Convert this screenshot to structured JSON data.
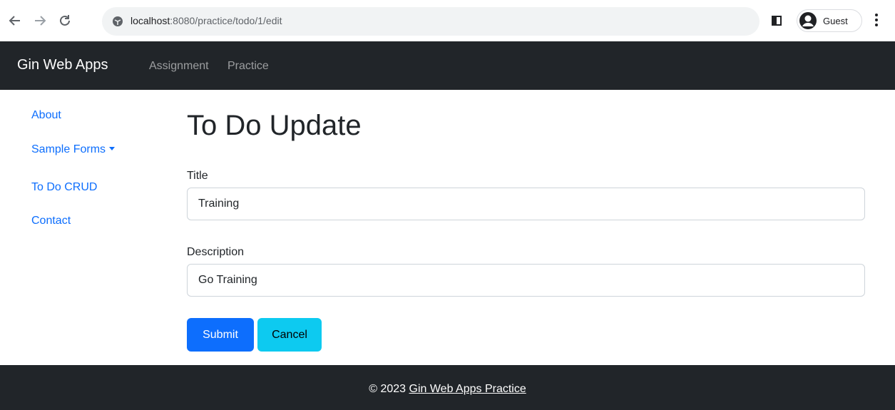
{
  "browser": {
    "url_host": "localhost",
    "url_path": ":8080/practice/todo/1/edit",
    "profile_label": "Guest"
  },
  "navbar": {
    "brand": "Gin Web Apps",
    "links": [
      "Assignment",
      "Practice"
    ]
  },
  "sidebar": {
    "items": [
      {
        "label": "About"
      },
      {
        "label": "Sample Forms",
        "has_dropdown": true
      },
      {
        "label": "To Do CRUD"
      },
      {
        "label": "Contact"
      }
    ]
  },
  "main": {
    "title": "To Do Update",
    "fields": [
      {
        "label": "Title",
        "value": "Training"
      },
      {
        "label": "Description",
        "value": "Go Training"
      }
    ],
    "buttons": {
      "submit": "Submit",
      "cancel": "Cancel"
    }
  },
  "footer": {
    "prefix": "© 2023",
    "link_text": "Gin Web Apps Practice"
  },
  "colors": {
    "navbar_bg": "#212529",
    "link": "#0d6efd",
    "primary": "#0d6efd",
    "info": "#0dcaf0"
  },
  "icons": [
    "back-arrow-icon",
    "forward-arrow-icon",
    "reload-icon",
    "site-info-icon",
    "side-panel-icon",
    "guest-avatar-icon",
    "more-menu-icon",
    "dropdown-caret-icon"
  ]
}
